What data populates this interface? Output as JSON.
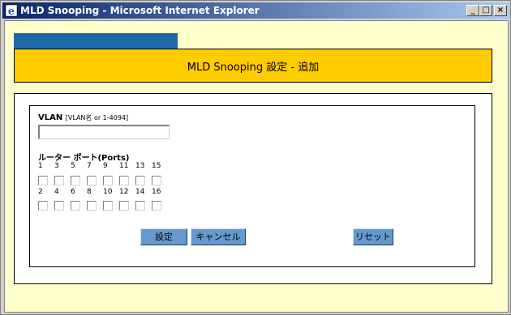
{
  "window": {
    "title": "MLD Snooping - Microsoft Internet Explorer",
    "minimize": "_",
    "maximize": "□",
    "close": "×"
  },
  "page": {
    "heading": "MLD Snooping 設定 - 追加"
  },
  "form": {
    "vlan_label": "VLAN",
    "vlan_hint": "[VLAN名 or 1-4094]",
    "vlan_value": "",
    "ports_label": "ルーター ポート(Ports)",
    "odd_ports": [
      "1",
      "3",
      "5",
      "7",
      "9",
      "11",
      "13",
      "15"
    ],
    "even_ports": [
      "2",
      "4",
      "6",
      "8",
      "10",
      "12",
      "14",
      "16"
    ]
  },
  "buttons": {
    "set": "設定",
    "cancel": "キャンセル",
    "reset": "リセット"
  },
  "colors": {
    "tab": "#1a6aa5",
    "header": "#ffcc00",
    "page_bg": "#ffffcc",
    "button": "#6699cc"
  }
}
